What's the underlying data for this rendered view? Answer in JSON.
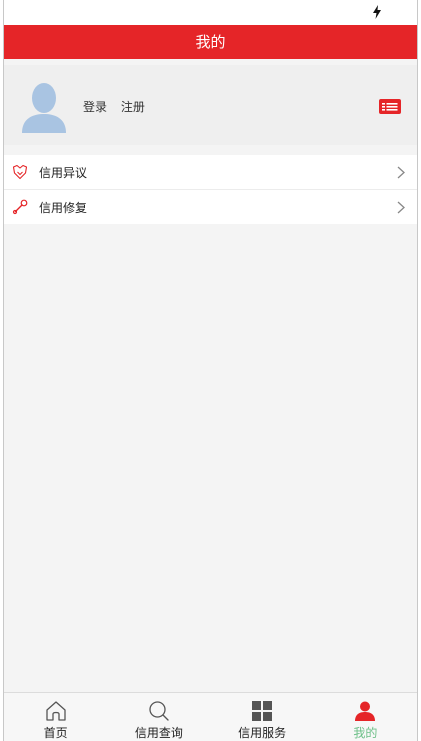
{
  "nav": {
    "title": "我的"
  },
  "profile": {
    "login": "登录",
    "register": "注册"
  },
  "menu": {
    "items": [
      {
        "label": "信用异议",
        "icon": "shield-outline-icon"
      },
      {
        "label": "信用修复",
        "icon": "wrench-icon"
      }
    ]
  },
  "tabbar": {
    "tabs": [
      {
        "label": "首页",
        "icon": "home-icon",
        "active": false
      },
      {
        "label": "信用查询",
        "icon": "search-icon",
        "active": false
      },
      {
        "label": "信用服务",
        "icon": "grid-icon",
        "active": false
      },
      {
        "label": "我的",
        "icon": "person-icon",
        "active": true
      }
    ]
  },
  "colors": {
    "brand_red": "#e52528",
    "active_tab": "#6cbf87",
    "background": "#f4f4f4",
    "avatar_blue": "#a9c4e2"
  }
}
